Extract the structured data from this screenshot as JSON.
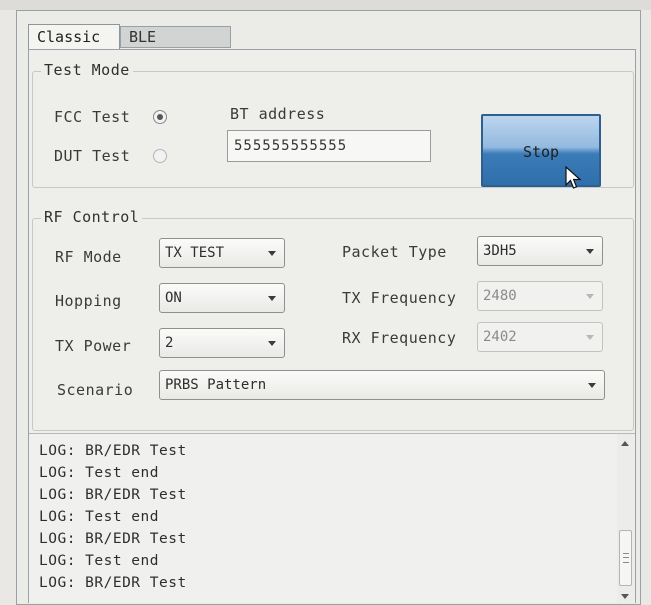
{
  "tabs": {
    "classic": "Classic",
    "ble": "BLE"
  },
  "test_mode": {
    "title": "Test Mode",
    "fcc_label": "FCC Test",
    "dut_label": "DUT Test",
    "bt_address_label": "BT address",
    "bt_address_value": "555555555555",
    "selected": "FCC Test",
    "stop_label": "Stop"
  },
  "rf_control": {
    "title": "RF Control",
    "rf_mode_label": "RF Mode",
    "rf_mode_value": "TX TEST",
    "hopping_label": "Hopping",
    "hopping_value": "ON",
    "tx_power_label": "TX Power",
    "tx_power_value": "2",
    "scenario_label": "Scenario",
    "scenario_value": "PRBS Pattern",
    "packet_type_label": "Packet Type",
    "packet_type_value": "3DH5",
    "tx_freq_label": "TX Frequency",
    "tx_freq_value": "2480",
    "rx_freq_label": "RX Frequency",
    "rx_freq_value": "2402"
  },
  "log": {
    "lines": [
      "LOG: BR/EDR Test",
      "LOG: Test end",
      "LOG: BR/EDR Test",
      "LOG: Test end",
      "LOG: BR/EDR Test",
      "LOG: Test end",
      "LOG: BR/EDR Test"
    ]
  },
  "colors": {
    "stop_button": "#3a7bb8",
    "panel_bg": "#eeeeeb"
  }
}
